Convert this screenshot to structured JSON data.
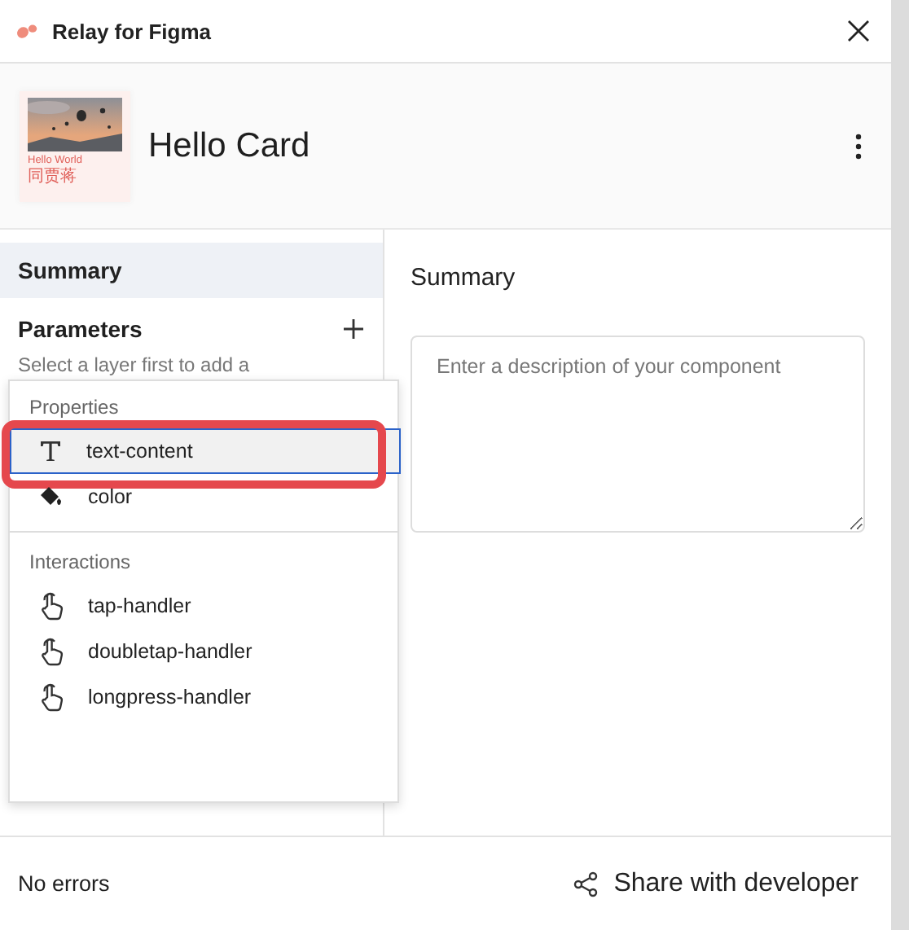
{
  "window": {
    "title": "Relay for Figma"
  },
  "component": {
    "name": "Hello Card",
    "thumbnail": {
      "title": "Hello World",
      "subtitle": "同贾蒋"
    }
  },
  "sidebar": {
    "items": [
      {
        "label": "Summary",
        "selected": true
      }
    ],
    "parameters": {
      "title": "Parameters",
      "hint": "Select a layer first to add a"
    }
  },
  "menu": {
    "sections": [
      {
        "title": "Properties",
        "items": [
          {
            "label": "text-content",
            "kind": "text",
            "selected": true,
            "highlighted": true
          },
          {
            "label": "color",
            "kind": "color",
            "selected": false,
            "highlighted": false
          }
        ]
      },
      {
        "title": "Interactions",
        "items": [
          {
            "label": "tap-handler",
            "kind": "gesture",
            "selected": false,
            "highlighted": false
          },
          {
            "label": "doubletap-handler",
            "kind": "gesture",
            "selected": false,
            "highlighted": false
          },
          {
            "label": "longpress-handler",
            "kind": "gesture",
            "selected": false,
            "highlighted": false
          }
        ]
      }
    ]
  },
  "summary": {
    "title": "Summary",
    "description": {
      "placeholder": "Enter a description of your component"
    }
  },
  "status_bar": {
    "status": "No errors",
    "share_button": "Share with developer"
  }
}
